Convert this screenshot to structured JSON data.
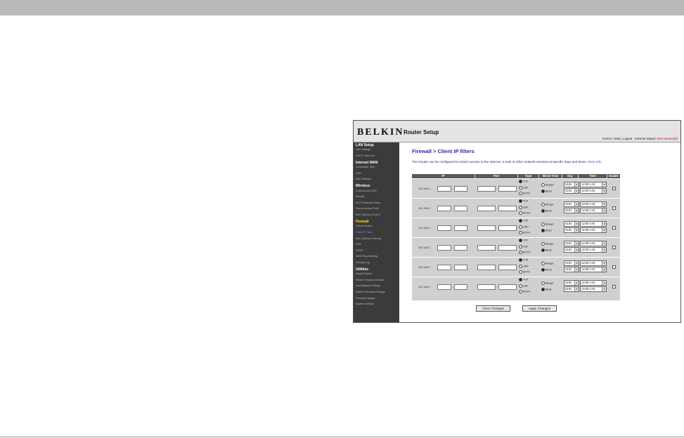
{
  "header": {
    "brand": "BELKIN",
    "title": "Router Setup",
    "links": [
      "Home",
      "Help",
      "Logout"
    ],
    "internet_status_label": "Internet Status:",
    "internet_status_value": "Not connected"
  },
  "sidebar": {
    "sections": [
      {
        "title": "LAN Setup",
        "items": [
          "LAN Settings",
          "DHCP Client List"
        ]
      },
      {
        "title": "Internet WAN",
        "items": [
          "Connection Type",
          "DNS",
          "MAC Address"
        ]
      },
      {
        "title": "Wireless",
        "items": [
          "Channel and SSID",
          "Security",
          "Wi-Fi Protected Setup",
          "Use as Access Point",
          "MAC Address Control"
        ]
      },
      {
        "title": "Firewall",
        "items": [
          "Virtual Servers",
          "Client IP Filters",
          "MAC Address Filtering",
          "DMZ",
          "DDNS",
          "WAN Ping Blocking",
          "Security Log"
        ]
      },
      {
        "title": "Utilities",
        "items": [
          "Restart Router",
          "Restore Factory Defaults",
          "Save/Backup Settings",
          "Restore Previous Settings",
          "Firmware Update",
          "System Settings"
        ]
      }
    ],
    "active_item": "Client IP Filters"
  },
  "page": {
    "title": "Firewall > Client IP filters",
    "description": "The Router can be configured to restrict access to the Internet, e-mail or other network services at specific days and times.",
    "more_info": "More Info"
  },
  "table": {
    "headers": [
      "IP",
      "Port",
      "Type",
      "Block Time",
      "Day",
      "Time",
      "Enable"
    ],
    "ip_prefix": "192.168.2.",
    "type_options": [
      "TCP",
      "UDP",
      "BOTH"
    ],
    "block_options": [
      "Always",
      "Block"
    ],
    "rows": [
      {
        "type": "TCP",
        "block": "Block",
        "day_from": "SUN",
        "day_to": "SUN",
        "time_from": "12:00 A.M.",
        "time_to": "12:00 A.M."
      },
      {
        "type": "TCP",
        "block": "Block",
        "day_from": "SUN",
        "day_to": "SUN",
        "time_from": "12:00 A.M.",
        "time_to": "12:00 A.M."
      },
      {
        "type": "TCP",
        "block": "Block",
        "day_from": "SUN",
        "day_to": "SUN",
        "time_from": "12:00 A.M.",
        "time_to": "12:00 A.M."
      },
      {
        "type": "TCP",
        "block": "Block",
        "day_from": "SUN",
        "day_to": "SUN",
        "time_from": "12:00 A.M.",
        "time_to": "12:00 A.M."
      },
      {
        "type": "TCP",
        "block": "Block",
        "day_from": "SUN",
        "day_to": "SUN",
        "time_from": "12:00 A.M.",
        "time_to": "12:00 A.M."
      },
      {
        "type": "TCP",
        "block": "Block",
        "day_from": "SUN",
        "day_to": "SUN",
        "time_from": "12:00 A.M.",
        "time_to": "12:00 A.M."
      }
    ]
  },
  "buttons": {
    "clear": "Clear Changes",
    "apply": "Apply Changes"
  },
  "colors": {
    "title_blue": "#2a2a9c",
    "sidebar_bg": "#3b3b3b",
    "firewall_yellow": "#ffe000",
    "status_red": "#cc0000"
  }
}
